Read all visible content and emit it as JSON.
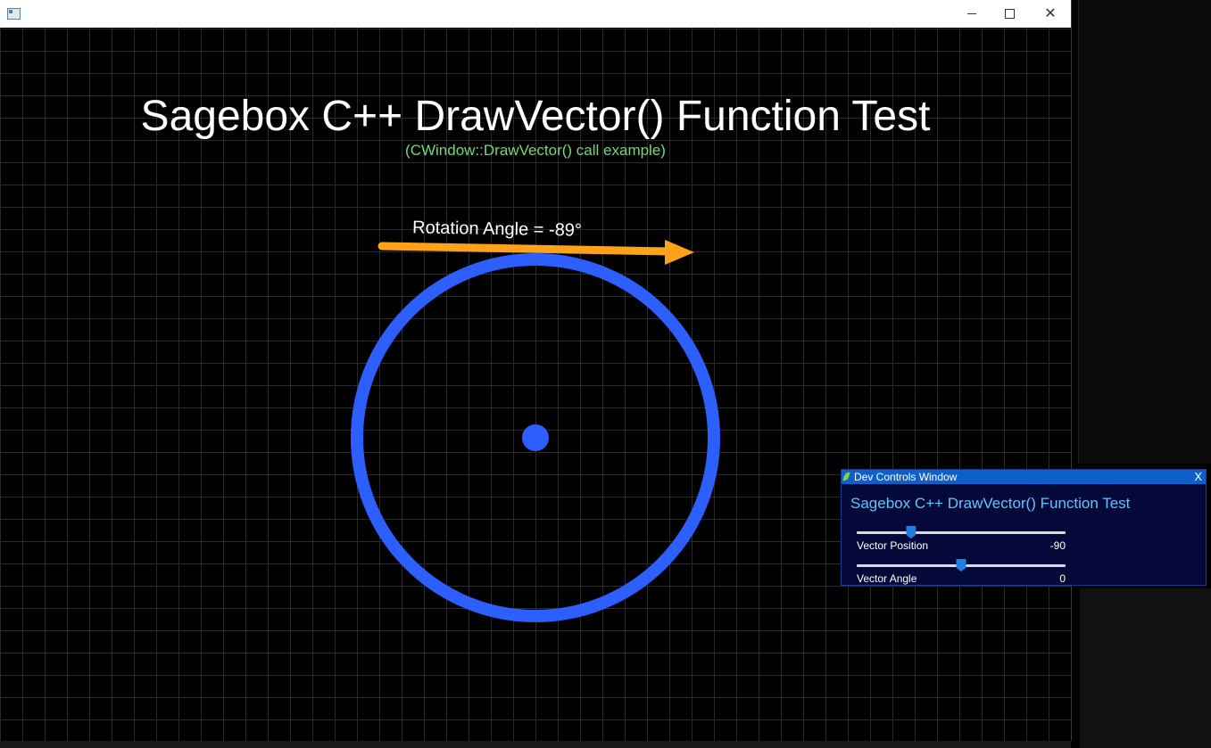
{
  "window": {
    "title": ""
  },
  "canvas": {
    "title": "Sagebox C++ DrawVector() Function Test",
    "subtitle": "(CWindow::DrawVector() call example)",
    "rotation_label": "Rotation Angle = -89°",
    "colors": {
      "title": "#ffffff",
      "subtitle": "#6fdc6f",
      "circle": "#2d5fff",
      "vector": "#ffa21a",
      "grid": "#2a2a2a"
    }
  },
  "dev_controls": {
    "window_title": "Dev Controls Window",
    "close_label": "X",
    "heading": "Sagebox C++ DrawVector() Function Test",
    "sliders": [
      {
        "label": "Vector Position",
        "value": "-90",
        "fraction": 0.26
      },
      {
        "label": "Vector Angle",
        "value": "0",
        "fraction": 0.5
      }
    ],
    "colors": {
      "background": "#05093a",
      "titlebar": "#0f5fcb",
      "heading": "#5ac8ff",
      "thumb": "#1f7fe0"
    }
  }
}
